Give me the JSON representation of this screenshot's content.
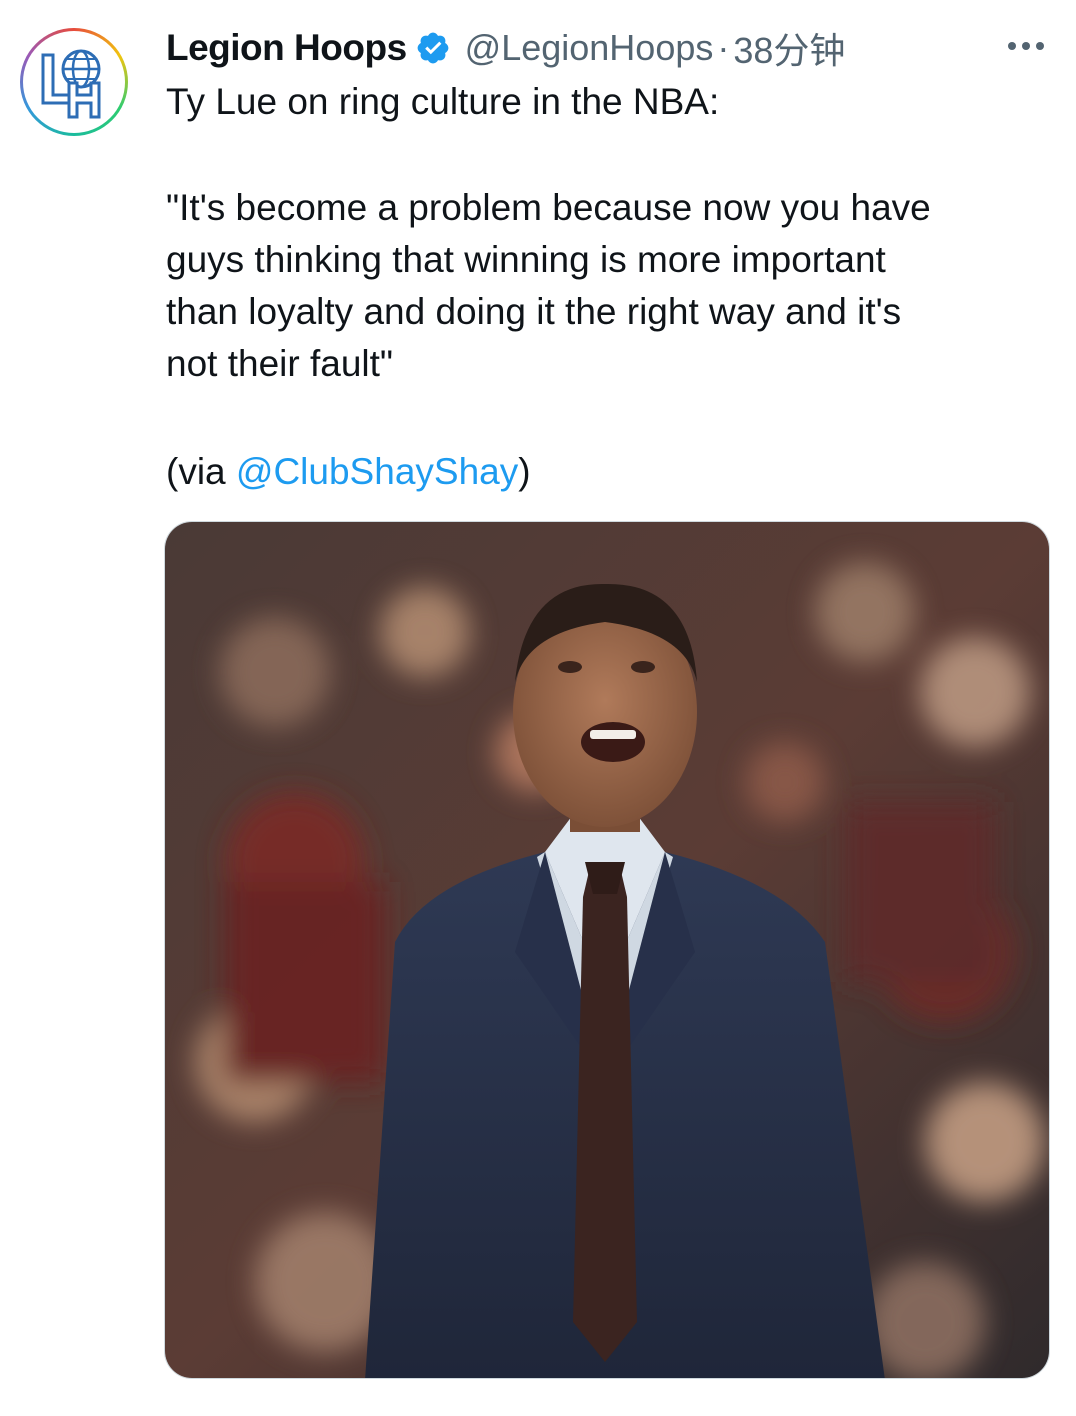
{
  "author": {
    "display_name": "Legion Hoops",
    "handle": "@LegionHoops",
    "separator": "·",
    "time": "38分钟",
    "avatar_icon": "legion-hoops-logo-icon",
    "verified_icon": "verified-badge-icon",
    "verified_color": "#1d9bf0"
  },
  "tweet": {
    "line1": "Ty Lue on ring culture in the NBA:",
    "quote_lines": [
      "\"It's become a problem because now you have",
      "guys thinking that winning is more important",
      "than loyalty and doing it the right way and it's",
      "not their fault\""
    ],
    "via_prefix": "(via ",
    "via_mention": "@ClubShayShay",
    "via_suffix": ")"
  },
  "menu": {
    "icon": "more-options-icon"
  },
  "colors": {
    "link": "#1d9bf0",
    "secondary_text": "#536471",
    "primary_text": "#0f1419"
  }
}
